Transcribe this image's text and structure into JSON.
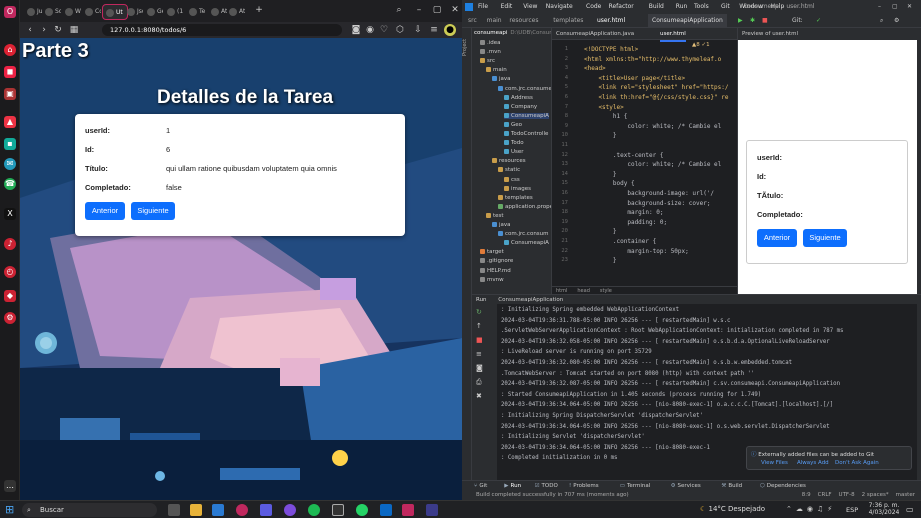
{
  "browser": {
    "tabs": [
      "Juan",
      "Sou",
      "Wel",
      "Cor",
      "Ut",
      "Jsor",
      "Gett",
      "(155",
      "Teor",
      "Atta",
      "Atta"
    ],
    "active_tab_index": 4,
    "url": "127.0.0.1:8080/todos/6",
    "page": {
      "banner": "Parte 3",
      "title": "Detalles de la Tarea",
      "fields": [
        {
          "label": "userId:",
          "value": "1"
        },
        {
          "label": "Id:",
          "value": "6"
        },
        {
          "label": "Título:",
          "value": "qui ullam ratione quibusdam voluptatem quia omnis"
        },
        {
          "label": "Completado:",
          "value": "false"
        }
      ],
      "prev_button": "Anterior",
      "next_button": "Siguiente"
    }
  },
  "ide": {
    "menu": [
      "File",
      "Edit",
      "View",
      "Navigate",
      "Code",
      "Refactor",
      "Build",
      "Run",
      "Tools",
      "Git",
      "Window",
      "Help"
    ],
    "window_title": "consumeapi - user.html",
    "breadcrumb": [
      "src",
      "main",
      "resources",
      "templates",
      "user.html"
    ],
    "run_config": "ConsumeapiApplication",
    "project_panel_label": "Project",
    "project_root": "consumeapi",
    "project_root_path": "D:\\UDB\\Consumeapi",
    "tree": [
      ".idea",
      ".mvn",
      "src",
      "main",
      "java",
      "com.jrc.consumea",
      "Address",
      "Company",
      "ConsumeapiA",
      "Geo",
      "TodoControlle",
      "Todo",
      "User",
      "resources",
      "static",
      "css",
      "images",
      "templates",
      "application.prope",
      "test",
      "java",
      "com.jrc.consum",
      "ConsumeapiA",
      "target",
      ".gitignore",
      "HELP.md",
      "mvnw"
    ],
    "editor_tabs": [
      "ConsumeapiApplication.java",
      "user.html",
      "Preview of user.html"
    ],
    "code_lines": [
      "<!DOCTYPE html>",
      "<html xmlns:th=\"http://www.thymeleaf.o",
      "<head>",
      "    <title>User page</title>",
      "    <link rel=\"stylesheet\" href=\"https:/",
      "    <link th:href=\"@{/css/style.css}\" re",
      "    <style>",
      "        h1 {",
      "            color: white; /* Cambie el",
      "        }",
      "",
      "        .text-center {",
      "            color: white; /* Cambie el",
      "        }",
      "        body {",
      "            background-image: url('/",
      "            background-size: cover;",
      "            margin: 0;",
      "            padding: 0;",
      "        }",
      "        .container {",
      "            margin-top: 50px;",
      "        }"
    ],
    "inspection": "▲8 ✓1",
    "code_crumbs": [
      "html",
      "head",
      "style"
    ],
    "preview": {
      "labels": [
        "userId:",
        "Id:",
        "TÃtulo:",
        "Completado:"
      ],
      "prev_button": "Anterior",
      "next_button": "Siguiente"
    },
    "run_tab": "Run",
    "run_config_tab": "ConsumeapiApplication",
    "console": [
      " : Initializing Spring embedded WebApplicationContext",
      "2024-03-04T19:36:31.788-05:00  INFO 26256 --- [  restartedMain] w.s.c",
      " .ServletWebServerApplicationContext : Root WebApplicationContext: initialization completed in 787 ms",
      "2024-03-04T19:36:32.058-05:00  INFO 26256 --- [  restartedMain] o.s.b.d.a.OptionalLiveReloadServer",
      "   : LiveReload server is running on port 35729",
      "2024-03-04T19:36:32.080-05:00  INFO 26256 --- [  restartedMain] o.s.b.w.embedded.tomcat",
      " .TomcatWebServer  : Tomcat started on port 8080 (http) with context path ''",
      "2024-03-04T19:36:32.087-05:00  INFO 26256 --- [  restartedMain] c.sv.consumeapi.ConsumeapiApplication",
      "   : Started ConsumeapiApplication in 1.405 seconds (process running for 1.749)",
      "2024-03-04T19:36:34.064-05:00  INFO 26256 --- [nio-8080-exec-1] o.a.c.c.C.[Tomcat].[localhost].[/]",
      "   : Initializing Spring DispatcherServlet 'dispatcherServlet'",
      "2024-03-04T19:36:34.064-05:00  INFO 26256 --- [nio-8080-exec-1] o.s.web.servlet.DispatcherServlet",
      "   : Initializing Servlet 'dispatcherServlet'",
      "2024-03-04T19:36:34.064-05:00  INFO 26256 --- [nio-8080-exec-1",
      "   : Completed initialization in 0 ms"
    ],
    "notification": {
      "message": "Externally added files can be added to Git",
      "actions": [
        "View Files",
        "Always Add",
        "Don't Ask Again"
      ]
    },
    "bottom_tabs": [
      "Git",
      "Run",
      "TODO",
      "Problems",
      "Terminal",
      "Services",
      "Build",
      "Dependencies"
    ],
    "status_left": "Build completed successfully in 707 ms (moments ago)",
    "status_right": [
      "8:9",
      "CRLF",
      "UTF-8",
      "2 spaces*",
      "master"
    ]
  },
  "taskbar": {
    "search_placeholder": "Buscar",
    "weather": "14°C  Despejado",
    "lang": "ESP",
    "time": "7:36 p. m.",
    "date": "4/03/2024"
  },
  "colors": {
    "accent": "#0d6efd",
    "browser_active": "#c0285e",
    "ide_bg": "#1e1f22"
  }
}
